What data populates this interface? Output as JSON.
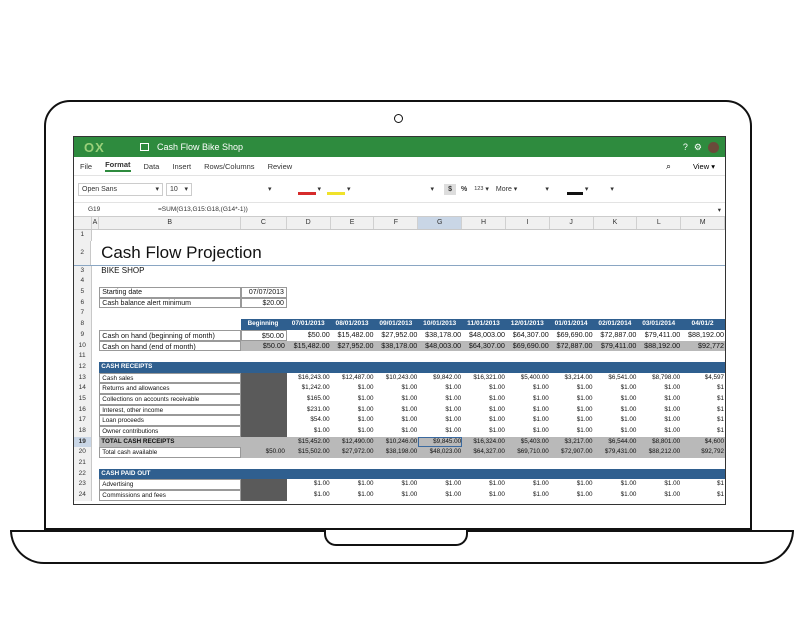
{
  "app": {
    "logo": "OX",
    "doc_title": "Cash Flow Bike Shop",
    "view_label": "View"
  },
  "menu": [
    "File",
    "Format",
    "Data",
    "Insert",
    "Rows/Columns",
    "Review"
  ],
  "toolbar": {
    "font": "Open Sans",
    "size": "10",
    "currency": "$",
    "percent": "%",
    "number_format": "123",
    "more": "More"
  },
  "formula": {
    "cell": "G19",
    "text": "=SUM(G13,G15:G18,(G14*-1))"
  },
  "columns": [
    "A",
    "B",
    "C",
    "D",
    "E",
    "F",
    "G",
    "H",
    "I",
    "J",
    "K",
    "L",
    "M"
  ],
  "sheet": {
    "title": "Cash Flow Projection",
    "subtitle": "BIKE SHOP",
    "starting_date_label": "Starting date",
    "starting_date": "07/07/2013",
    "alert_label": "Cash balance alert minimum",
    "alert_value": "$20.00",
    "header_row": [
      "Beginning",
      "07/01/2013",
      "08/01/2013",
      "09/01/2013",
      "10/01/2013",
      "11/01/2013",
      "12/01/2013",
      "01/01/2014",
      "02/01/2014",
      "03/01/2014",
      "04/01/2"
    ],
    "cash_begin_label": "Cash on hand (beginning of month)",
    "cash_begin": [
      "$50.00",
      "$50.00",
      "$15,482.00",
      "$27,952.00",
      "$38,178.00",
      "$48,003.00",
      "$64,307.00",
      "$69,690.00",
      "$72,887.00",
      "$79,411.00",
      "$88,192.00"
    ],
    "cash_end_label": "Cash on hand (end of month)",
    "cash_end": [
      "$50.00",
      "$15,482.00",
      "$27,952.00",
      "$38,178.00",
      "$48,003.00",
      "$64,307.00",
      "$69,690.00",
      "$72,887.00",
      "$79,411.00",
      "$88,192.00",
      "$92,772"
    ],
    "receipts_header": "CASH RECEIPTS",
    "receipts": [
      {
        "label": "Cash sales",
        "values": [
          "$16,243.00",
          "$12,487.00",
          "$10,243.00",
          "$9,842.00",
          "$16,321.00",
          "$5,400.00",
          "$3,214.00",
          "$6,541.00",
          "$8,798.00",
          "$4,597"
        ]
      },
      {
        "label": "Returns and allowances",
        "values": [
          "$1,242.00",
          "$1.00",
          "$1.00",
          "$1.00",
          "$1.00",
          "$1.00",
          "$1.00",
          "$1.00",
          "$1.00",
          "$1"
        ]
      },
      {
        "label": "Collections on accounts receivable",
        "values": [
          "$165.00",
          "$1.00",
          "$1.00",
          "$1.00",
          "$1.00",
          "$1.00",
          "$1.00",
          "$1.00",
          "$1.00",
          "$1"
        ]
      },
      {
        "label": "Interest, other income",
        "values": [
          "$231.00",
          "$1.00",
          "$1.00",
          "$1.00",
          "$1.00",
          "$1.00",
          "$1.00",
          "$1.00",
          "$1.00",
          "$1"
        ]
      },
      {
        "label": "Loan proceeds",
        "values": [
          "$54.00",
          "$1.00",
          "$1.00",
          "$1.00",
          "$1.00",
          "$1.00",
          "$1.00",
          "$1.00",
          "$1.00",
          "$1"
        ]
      },
      {
        "label": "Owner contributions",
        "values": [
          "$1.00",
          "$1.00",
          "$1.00",
          "$1.00",
          "$1.00",
          "$1.00",
          "$1.00",
          "$1.00",
          "$1.00",
          "$1"
        ]
      }
    ],
    "total_receipts": {
      "label": "TOTAL CASH RECEIPTS",
      "values": [
        "$15,452.00",
        "$12,490.00",
        "$10,246.00",
        "$9,845.00",
        "$16,324.00",
        "$5,403.00",
        "$3,217.00",
        "$6,544.00",
        "$8,801.00",
        "$4,600"
      ]
    },
    "total_available": {
      "label": "Total cash available",
      "begin": "$50.00",
      "values": [
        "$15,502.00",
        "$27,972.00",
        "$38,198.00",
        "$48,023.00",
        "$64,327.00",
        "$69,710.00",
        "$72,907.00",
        "$79,431.00",
        "$88,212.00",
        "$92,792"
      ]
    },
    "paid_header": "CASH PAID OUT",
    "paid": [
      {
        "label": "Advertising",
        "values": [
          "$1.00",
          "$1.00",
          "$1.00",
          "$1.00",
          "$1.00",
          "$1.00",
          "$1.00",
          "$1.00",
          "$1.00",
          "$1"
        ]
      },
      {
        "label": "Commissions and fees",
        "values": [
          "$1.00",
          "$1.00",
          "$1.00",
          "$1.00",
          "$1.00",
          "$1.00",
          "$1.00",
          "$1.00",
          "$1.00",
          "$1"
        ]
      }
    ]
  }
}
